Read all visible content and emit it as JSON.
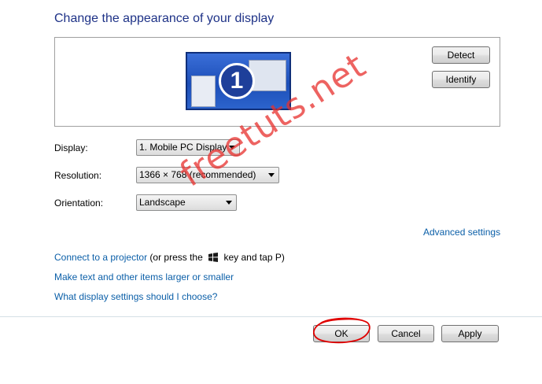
{
  "page": {
    "title": "Change the appearance of your display"
  },
  "preview": {
    "monitor_number": "1",
    "detect_label": "Detect",
    "identify_label": "Identify"
  },
  "settings": {
    "display_label": "Display:",
    "display_value": "1. Mobile PC Display",
    "resolution_label": "Resolution:",
    "resolution_value": "1366 × 768 (recommended)",
    "orientation_label": "Orientation:",
    "orientation_value": "Landscape"
  },
  "links": {
    "advanced_settings": "Advanced settings",
    "connect_projector": "Connect to a projector",
    "connect_projector_hint_pre": "(or press the",
    "connect_projector_hint_post": "key and tap P)",
    "make_text_larger": "Make text and other items larger or smaller",
    "what_settings": "What display settings should I choose?"
  },
  "footer": {
    "ok_label": "OK",
    "cancel_label": "Cancel",
    "apply_label": "Apply"
  },
  "watermark": {
    "text": "freetuts.net",
    "color": "#e8302d"
  },
  "colors": {
    "title": "#1e3287",
    "link": "#0b5fa8",
    "annotation_circle": "#e00000"
  }
}
